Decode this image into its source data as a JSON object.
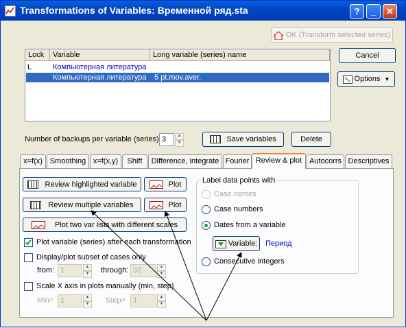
{
  "window": {
    "title": "Transformations of Variables: Временной ряд.sta"
  },
  "titlebar_buttons": {
    "help": "?",
    "minimize": "_",
    "close": "✕"
  },
  "buttons": {
    "ok": "OK (Transform selected series)",
    "cancel": "Cancel",
    "options": "Options",
    "save_variables": "Save variables",
    "delete": "Delete",
    "review_highlighted": "Review highlighted variable",
    "review_multiple": "Review multiple variables",
    "plot": "Plot",
    "plot_two_lists": "Plot two var lists with different scales",
    "variable": "Variable:"
  },
  "series_table": {
    "headers": [
      "Lock",
      "Variable",
      "Long variable (series) name"
    ],
    "rows": [
      {
        "lock": "L",
        "variable": "Компьютерная литература",
        "long": ""
      },
      {
        "lock": "",
        "variable": "Компьютерная литература",
        "long": "5 pt.mov.aver."
      }
    ],
    "selected_row": 1
  },
  "backups": {
    "label": "Number of backups per variable (series):",
    "value": "3"
  },
  "tabs": [
    "x=f(x)",
    "Smoothing",
    "x=f(x,y)",
    "Shift",
    "Difference, integrate",
    "Fourier",
    "Review & plot",
    "Autocorrs",
    "Descriptives"
  ],
  "active_tab": "Review & plot",
  "options": {
    "plot_after_each": {
      "label": "Plot variable (series) after each transformation",
      "checked": true
    },
    "display_subset": {
      "label": "Display/plot subset of cases only",
      "checked": false
    },
    "from_label": "from:",
    "from_value": "1",
    "through_label": "through:",
    "through_value": "32",
    "scale_x": {
      "label": "Scale X axis in plots manually (min, step)",
      "checked": false
    },
    "min_label": "Min=",
    "min_value": "1",
    "step_label": "Step=",
    "step_value": "1"
  },
  "label_group": {
    "title": "Label data points with",
    "case_names": "Case names",
    "case_numbers": "Case numbers",
    "dates_from_variable": "Dates from a variable",
    "selected_variable": "Период",
    "consecutive_integers": "Consecutive integers",
    "selected": "dates_from_variable"
  },
  "colors": {
    "link": "#0000cc",
    "selection": "#316ac5",
    "accent": "#e68b2c"
  }
}
